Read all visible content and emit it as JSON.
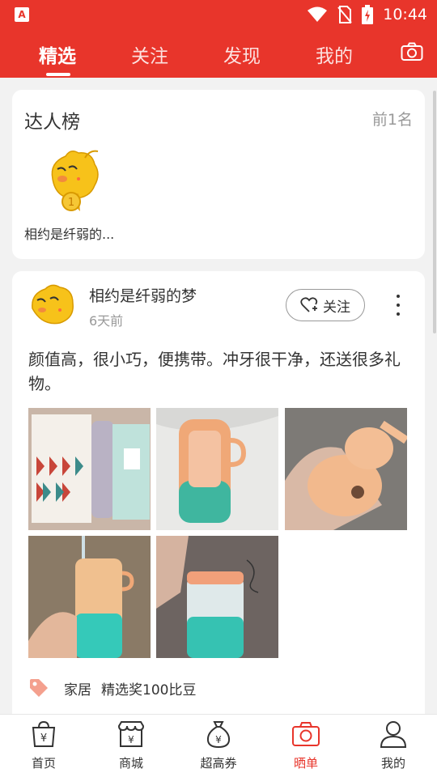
{
  "status_bar": {
    "time": "10:44",
    "app_badge": "A"
  },
  "header": {
    "tabs": [
      {
        "label": "精选",
        "active": true
      },
      {
        "label": "关注",
        "active": false
      },
      {
        "label": "发现",
        "active": false
      },
      {
        "label": "我的",
        "active": false
      }
    ],
    "camera_icon": "camera-icon"
  },
  "ranking": {
    "title": "达人榜",
    "more": "前1名",
    "top_user": {
      "name": "相约是纤弱的...",
      "rank": "1"
    }
  },
  "post": {
    "username": "相约是纤弱的梦",
    "time": "6天前",
    "follow_label": "关注",
    "text": "颜值高，很小巧，便携带。冲牙很干净，还送很多礼物。",
    "photo_count": 5,
    "tags": [
      "家居",
      "精选奖100比豆"
    ]
  },
  "bottom_nav": [
    {
      "label": "首页",
      "icon": "shopping-bag-yen-icon",
      "active": false
    },
    {
      "label": "商城",
      "icon": "store-icon",
      "active": false
    },
    {
      "label": "超高券",
      "icon": "money-bag-icon",
      "active": false
    },
    {
      "label": "晒单",
      "icon": "camera-icon",
      "active": true
    },
    {
      "label": "我的",
      "icon": "user-icon",
      "active": false
    }
  ],
  "colors": {
    "brand_red": "#e8352b",
    "text": "#333333",
    "muted": "#999999",
    "page_bg": "#f2f2f2"
  }
}
